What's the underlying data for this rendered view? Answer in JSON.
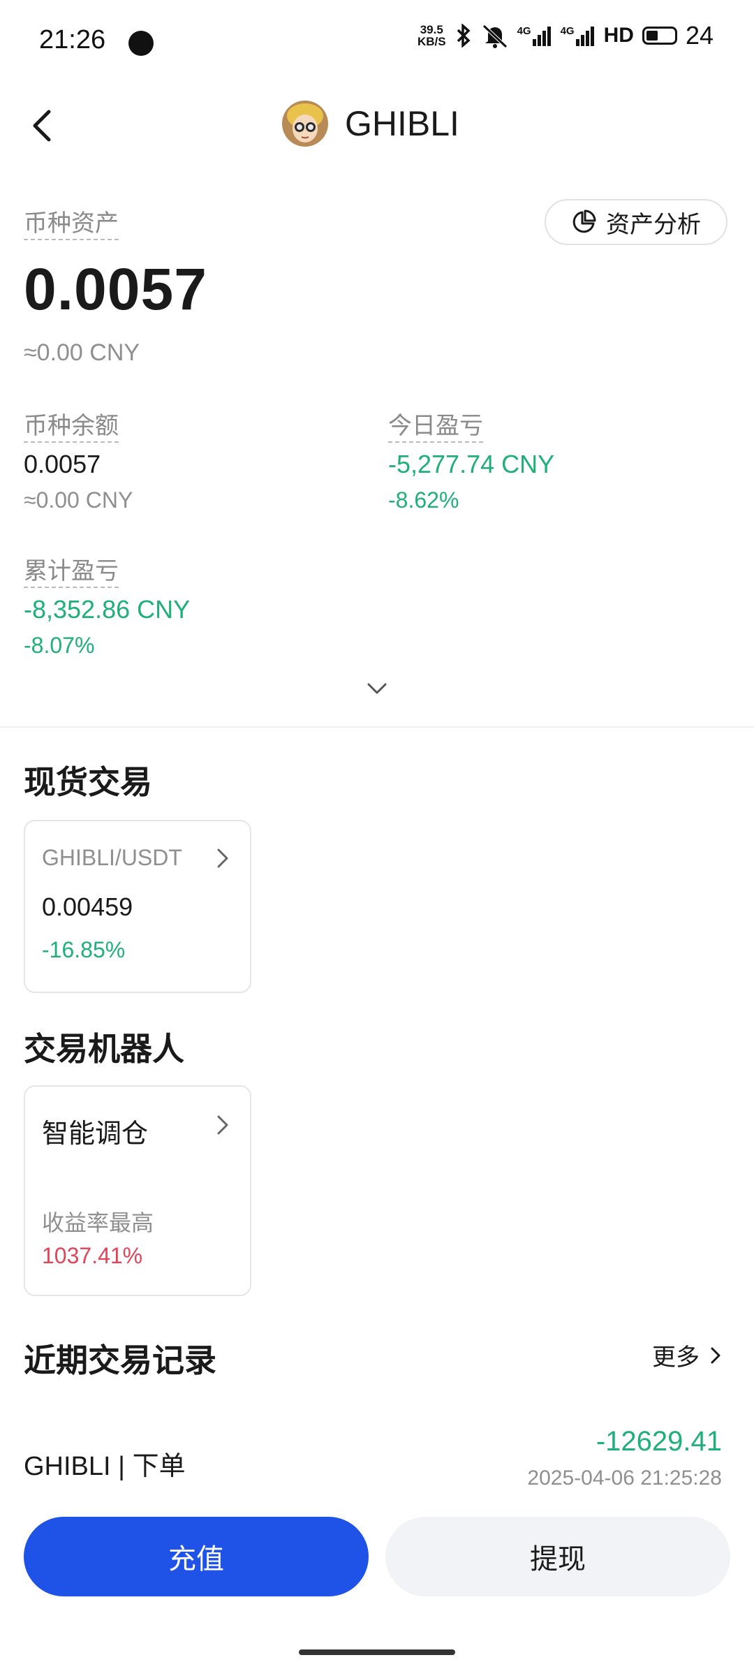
{
  "status_bar": {
    "time": "21:26",
    "net_speed_top": "39.5",
    "net_speed_bottom": "KB/S",
    "bluetooth_icon": "bluetooth-icon",
    "mute_icon": "bell-mute-icon",
    "signal1_label": "4G",
    "signal2_label": "4G",
    "hd_label": "HD",
    "battery": "24"
  },
  "header": {
    "title": "GHIBLI",
    "back_icon": "chevron-left-icon"
  },
  "asset": {
    "label": "币种资产",
    "amount": "0.0057",
    "approx": "≈0.00 CNY",
    "analysis_button": "资产分析",
    "analysis_icon": "pie-chart-icon"
  },
  "stats": {
    "balance_label": "币种余额",
    "balance_value": "0.0057",
    "balance_approx": "≈0.00 CNY",
    "today_label": "今日盈亏",
    "today_value": "-5,277.74 CNY",
    "today_pct": "-8.62%",
    "total_label": "累计盈亏",
    "total_value": "-8,352.86 CNY",
    "total_pct": "-8.07%"
  },
  "spot": {
    "title": "现货交易",
    "pair": "GHIBLI/USDT",
    "price": "0.00459",
    "change": "-16.85%"
  },
  "bots": {
    "title": "交易机器人",
    "name": "智能调仓",
    "yield_label": "收益率最高",
    "yield_value": "1037.41%"
  },
  "records": {
    "title": "近期交易记录",
    "more": "更多",
    "items": [
      {
        "name": "GHIBLI | 下单",
        "amount": "-12629.41",
        "time": "2025-04-06 21:25:28"
      }
    ]
  },
  "actions": {
    "deposit": "充值",
    "withdraw": "提现"
  },
  "colors": {
    "primary": "#1f52e6",
    "positive_green": "#1fb07a",
    "negative_red": "#e0455a"
  }
}
